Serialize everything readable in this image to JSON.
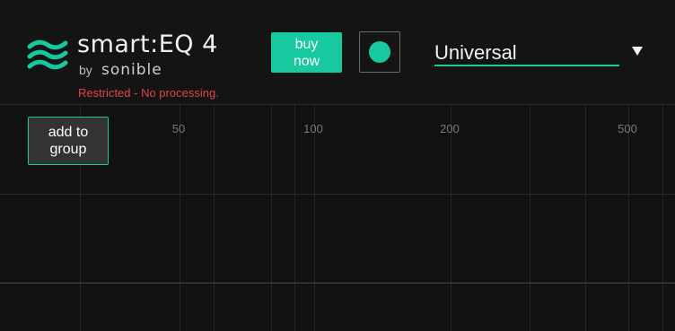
{
  "brand": {
    "product": "smart:EQ 4",
    "by": "by",
    "company": "sonible",
    "logo_icon": "sonible-waves-icon",
    "accent_color": "#17c99e"
  },
  "status": {
    "restricted": "Restricted - No processing.",
    "color": "#e0444a"
  },
  "header": {
    "buy_label": "buy\nnow",
    "bypass_toggle_icon": "power-dot-icon",
    "profile": "Universal",
    "dropdown_icon": "caret-down-icon"
  },
  "graph": {
    "freq_labels": [
      "50",
      "100",
      "200",
      "500"
    ],
    "add_group_label": "add to\ngroup"
  }
}
